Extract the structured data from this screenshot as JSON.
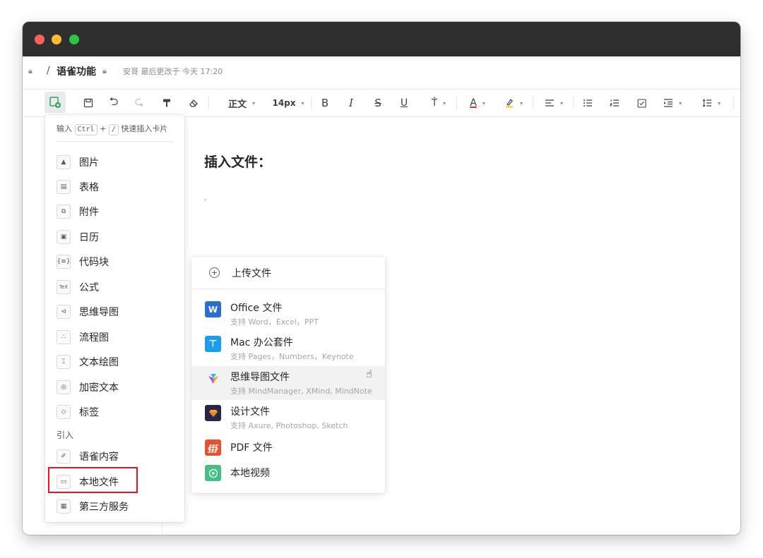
{
  "header": {
    "slash": "/",
    "title": "语雀功能",
    "meta": "安哥 最后更改于 今天 17:20"
  },
  "toolbar": {
    "style_label": "正文",
    "font_size": "14px",
    "bold": "B",
    "italic": "I",
    "strike": "S",
    "underline": "U",
    "font_color": "A",
    "caret": "▾"
  },
  "editor": {
    "heading": "插入文件：",
    "placeholder": "."
  },
  "insert_panel": {
    "hint_prefix": "输入",
    "hint_ctrl": "Ctrl",
    "hint_plus": "+",
    "hint_slash": "/",
    "hint_suffix": "快速插入卡片",
    "items": [
      {
        "label": "图片",
        "icon": "image-icon"
      },
      {
        "label": "表格",
        "icon": "table-icon"
      },
      {
        "label": "附件",
        "icon": "attachment-icon"
      },
      {
        "label": "日历",
        "icon": "calendar-icon"
      },
      {
        "label": "代码块",
        "icon": "code-icon"
      },
      {
        "label": "公式",
        "icon": "formula-icon"
      },
      {
        "label": "思维导图",
        "icon": "mindmap-icon"
      },
      {
        "label": "流程图",
        "icon": "flowchart-icon"
      },
      {
        "label": "文本绘图",
        "icon": "text-diagram-icon"
      },
      {
        "label": "加密文本",
        "icon": "lock-text-icon"
      },
      {
        "label": "标签",
        "icon": "tag-icon"
      }
    ],
    "section_import": "引入",
    "import_items": [
      {
        "label": "语雀内容",
        "icon": "yuque-content-icon"
      },
      {
        "label": "本地文件",
        "icon": "folder-icon"
      },
      {
        "label": "第三方服务",
        "icon": "third-party-icon"
      }
    ]
  },
  "file_menu": {
    "upload": "上传文件",
    "items": [
      {
        "name": "Office 文件",
        "sub": "支持 Word，Excel，PPT",
        "icon": "word-icon",
        "color": "#2b6dd3"
      },
      {
        "name": "Mac 办公套件",
        "sub": "支持 Pages，Numbers，Keynote",
        "icon": "keynote-icon",
        "color": "#1a9ef0"
      },
      {
        "name": "思维导图文件",
        "sub": "支持 MindManager, XMind, MindNote",
        "icon": "mindmap-file-icon",
        "color": "#e0553a"
      },
      {
        "name": "设计文件",
        "sub": "支持 Axure, Photoshop, Sketch",
        "icon": "sketch-icon",
        "color": "#28244a"
      },
      {
        "name": "PDF 文件",
        "icon": "pdf-icon",
        "color": "#e8512e"
      },
      {
        "name": "本地视频",
        "icon": "video-icon",
        "color": "#45bd83"
      }
    ]
  }
}
